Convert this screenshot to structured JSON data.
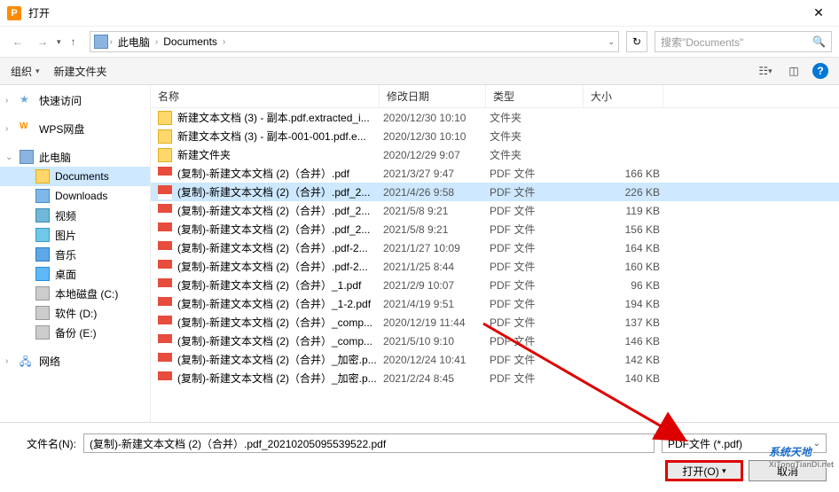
{
  "title": "打开",
  "breadcrumb": {
    "seg1": "此电脑",
    "seg2": "Documents"
  },
  "search_placeholder": "搜索\"Documents\"",
  "toolbar": {
    "organize": "组织",
    "newfolder": "新建文件夹"
  },
  "sidebar": {
    "quick": "快速访问",
    "wps": "WPS网盘",
    "pc": "此电脑",
    "documents": "Documents",
    "downloads": "Downloads",
    "videos": "视频",
    "pictures": "图片",
    "music": "音乐",
    "desktop": "桌面",
    "cdrive": "本地磁盘 (C:)",
    "ddrive": "软件 (D:)",
    "edrive": "备份 (E:)",
    "network": "网络"
  },
  "columns": {
    "name": "名称",
    "date": "修改日期",
    "type": "类型",
    "size": "大小"
  },
  "type_folder": "文件夹",
  "type_pdf": "PDF 文件",
  "files": [
    {
      "icon": "folder",
      "name": "新建文本文档 (3) - 副本.pdf.extracted_i...",
      "date": "2020/12/30 10:10",
      "type": "文件夹",
      "size": ""
    },
    {
      "icon": "folder",
      "name": "新建文本文档 (3) - 副本-001-001.pdf.e...",
      "date": "2020/12/30 10:10",
      "type": "文件夹",
      "size": ""
    },
    {
      "icon": "folder",
      "name": "新建文件夹",
      "date": "2020/12/29 9:07",
      "type": "文件夹",
      "size": ""
    },
    {
      "icon": "pdf",
      "name": "(复制)-新建文本文档 (2)（合并）.pdf",
      "date": "2021/3/27 9:47",
      "type": "PDF 文件",
      "size": "166 KB"
    },
    {
      "icon": "pdf",
      "name": "(复制)-新建文本文档 (2)（合并）.pdf_2...",
      "date": "2021/4/26 9:58",
      "type": "PDF 文件",
      "size": "226 KB",
      "selected": true
    },
    {
      "icon": "pdf",
      "name": "(复制)-新建文本文档 (2)（合并）.pdf_2...",
      "date": "2021/5/8 9:21",
      "type": "PDF 文件",
      "size": "119 KB"
    },
    {
      "icon": "pdf",
      "name": "(复制)-新建文本文档 (2)（合并）.pdf_2...",
      "date": "2021/5/8 9:21",
      "type": "PDF 文件",
      "size": "156 KB"
    },
    {
      "icon": "pdf",
      "name": "(复制)-新建文本文档 (2)（合并）.pdf-2...",
      "date": "2021/1/27 10:09",
      "type": "PDF 文件",
      "size": "164 KB"
    },
    {
      "icon": "pdf",
      "name": "(复制)-新建文本文档 (2)（合并）.pdf-2...",
      "date": "2021/1/25 8:44",
      "type": "PDF 文件",
      "size": "160 KB"
    },
    {
      "icon": "pdf",
      "name": "(复制)-新建文本文档 (2)（合并）_1.pdf",
      "date": "2021/2/9 10:07",
      "type": "PDF 文件",
      "size": "96 KB"
    },
    {
      "icon": "pdf",
      "name": "(复制)-新建文本文档 (2)（合并）_1-2.pdf",
      "date": "2021/4/19 9:51",
      "type": "PDF 文件",
      "size": "194 KB"
    },
    {
      "icon": "pdf",
      "name": "(复制)-新建文本文档 (2)（合并）_comp...",
      "date": "2020/12/19 11:44",
      "type": "PDF 文件",
      "size": "137 KB"
    },
    {
      "icon": "pdf",
      "name": "(复制)-新建文本文档 (2)（合并）_comp...",
      "date": "2021/5/10 9:10",
      "type": "PDF 文件",
      "size": "146 KB"
    },
    {
      "icon": "pdf",
      "name": "(复制)-新建文本文档 (2)（合并）_加密.p...",
      "date": "2020/12/24 10:41",
      "type": "PDF 文件",
      "size": "142 KB"
    },
    {
      "icon": "pdf",
      "name": "(复制)-新建文本文档 (2)（合并）_加密.p...",
      "date": "2021/2/24 8:45",
      "type": "PDF 文件",
      "size": "140 KB"
    }
  ],
  "filename_label": "文件名(N):",
  "filename_value": "(复制)-新建文本文档 (2)（合并）.pdf_20210205095539522.pdf",
  "filter_label": "PDF文件 (*.pdf)",
  "open_btn": "打开(O)",
  "cancel_btn": "取消",
  "watermark": "系统天地",
  "watermark_url": "XiTongTianDi.net"
}
